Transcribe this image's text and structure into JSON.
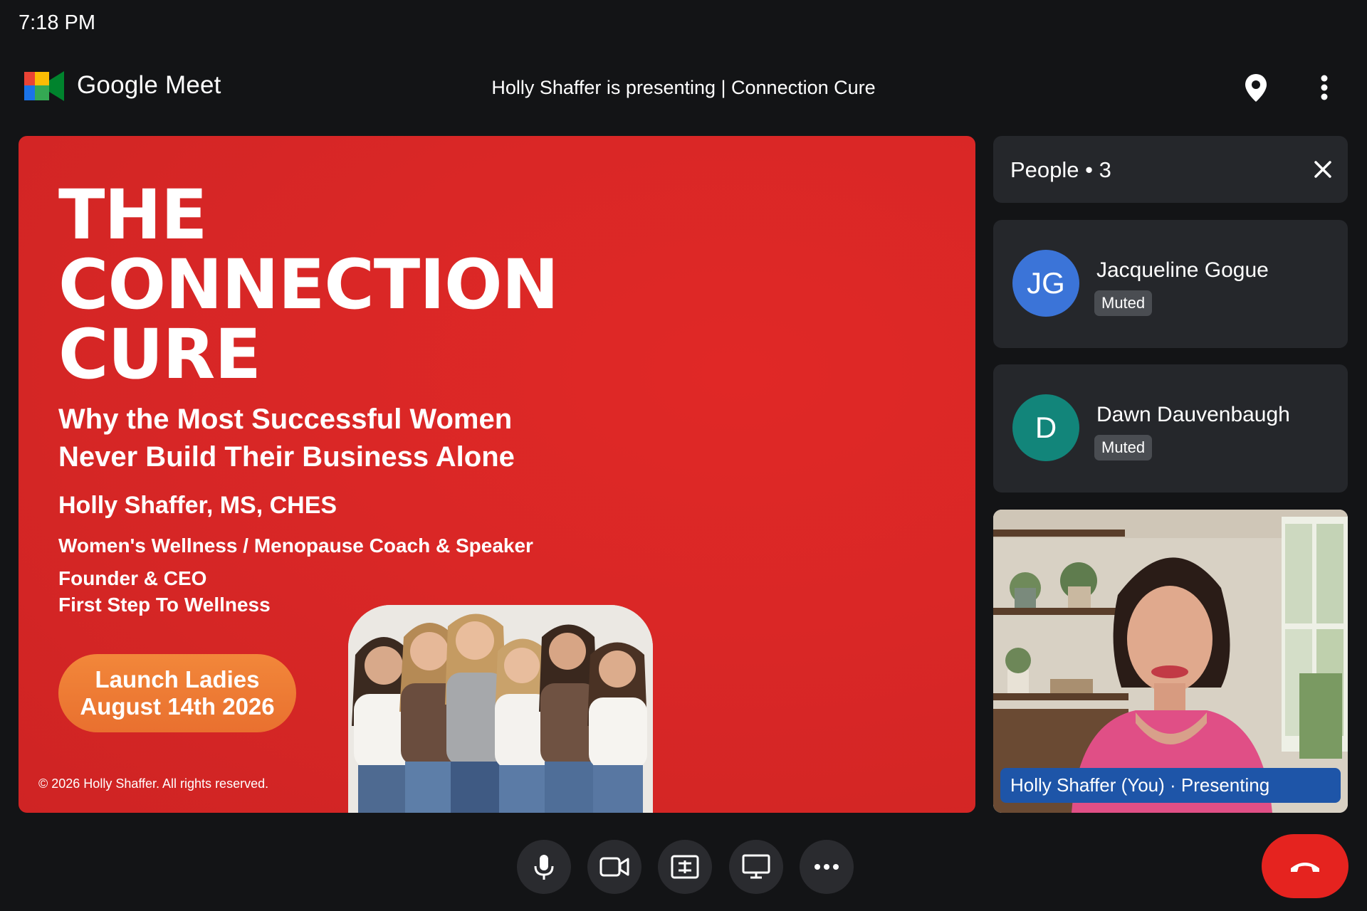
{
  "status_bar": {
    "time": "7:18 PM"
  },
  "header": {
    "brand": "Google Meet",
    "meeting_title": "Holly Shaffer is presenting | Connection Cure",
    "icons": [
      "meet-logo-icon",
      "location-pin-icon",
      "more-vert-icon"
    ]
  },
  "slide": {
    "title_lines": [
      "THE",
      "CONNECTION",
      "CURE"
    ],
    "subtitle_lines": [
      "Why the Most Successful Women",
      "Never Build Their Business Alone"
    ],
    "presenter_name": "Holly Shaffer, MS, CHES",
    "presenter_role": "Women's Wellness / Menopause Coach & Speaker",
    "company_lines": [
      "Founder & CEO",
      "First Step To Wellness"
    ],
    "launch_lines": [
      "Launch Ladies",
      "August 14th 2026"
    ],
    "copyright": "© 2026 Holly Shaffer. All rights reserved.",
    "background_color": "#d92726",
    "badge_color": "#ee7b35"
  },
  "people_panel": {
    "title": "People • 3",
    "participants": [
      {
        "initials": "JG",
        "name": "Jacqueline Gogue",
        "status": "Muted",
        "avatar_color": "#3b74d8"
      },
      {
        "initials": "D",
        "name": "Dawn Dauvenbaugh",
        "status": "Muted",
        "avatar_color": "#12857a"
      }
    ],
    "self_label": "Holly Shaffer (You) · Presenting"
  },
  "controls": {
    "icons": [
      "microphone-icon",
      "camera-icon",
      "captions-icon",
      "present-screen-icon",
      "more-options-icon"
    ],
    "leave_icon": "hang-up-icon",
    "leave_color": "#e5231f"
  }
}
